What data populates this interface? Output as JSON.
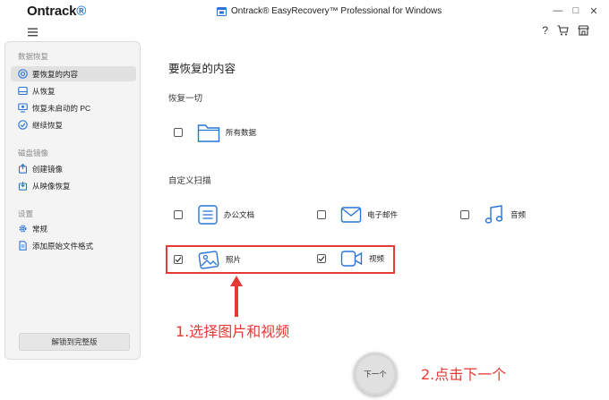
{
  "titlebar": {
    "brand": "Ontrack",
    "brand_dot": "®",
    "window_title": "Ontrack® EasyRecovery™ Professional for Windows",
    "min_label": "—",
    "max_label": "□",
    "close_label": "✕"
  },
  "toolbar": {
    "help_label": "?",
    "menu_icon": "hamburger-icon",
    "cart_icon": "cart-icon",
    "store_icon": "store-icon"
  },
  "sidebar": {
    "section_recovery": "数据恢复",
    "items_recovery": [
      {
        "label": "要恢复的内容",
        "icon": "target-icon",
        "active": true
      },
      {
        "label": "从恢复",
        "icon": "drive-icon"
      },
      {
        "label": "恢复未启动的 PC",
        "icon": "pc-icon"
      },
      {
        "label": "继续恢复",
        "icon": "resume-icon"
      }
    ],
    "section_image": "磁盘镜像",
    "items_image": [
      {
        "label": "创建镜像",
        "icon": "create-image-icon"
      },
      {
        "label": "从映像恢复",
        "icon": "restore-image-icon"
      }
    ],
    "section_settings": "设置",
    "items_settings": [
      {
        "label": "常规",
        "icon": "gear-icon"
      },
      {
        "label": "添加原始文件格式",
        "icon": "add-file-icon"
      }
    ],
    "unlock_label": "解锁到完整版"
  },
  "main": {
    "heading": "要恢复的内容",
    "section_all": "恢复一切",
    "all_data": {
      "label": "所有数据",
      "checked": false
    },
    "section_custom": "自定义扫描",
    "options": [
      {
        "label": "办公文档",
        "checked": false,
        "icon": "document-icon"
      },
      {
        "label": "电子邮件",
        "checked": false,
        "icon": "mail-icon"
      },
      {
        "label": "音频",
        "checked": false,
        "icon": "music-icon"
      },
      {
        "label": "照片",
        "checked": true,
        "icon": "photo-icon"
      },
      {
        "label": "视频",
        "checked": true,
        "icon": "video-icon"
      }
    ],
    "next_label": "下一个"
  },
  "annotations": {
    "step1": "1.选择图片和视频",
    "step2": "2.点击下一个",
    "color": "#e53935"
  },
  "colors": {
    "accent": "#2a74d6",
    "annotation_red": "#e53935",
    "sidebar_bg": "#f4f4f4"
  }
}
